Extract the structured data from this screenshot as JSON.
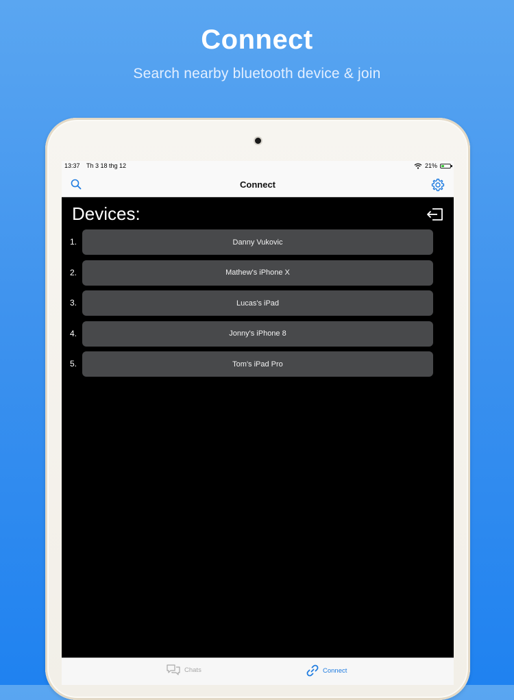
{
  "promo": {
    "title": "Connect",
    "subtitle": "Search nearby bluetooth device & join"
  },
  "status_bar": {
    "time": "13:37",
    "date": "Th 3 18 thg 12",
    "battery": "21%"
  },
  "nav": {
    "title": "Connect",
    "left_icon": "search-icon",
    "right_icon": "gear-icon"
  },
  "devices": {
    "header": "Devices:",
    "exit_icon": "exit-icon",
    "items": [
      {
        "index": "1.",
        "name": "Danny Vukovic"
      },
      {
        "index": "2.",
        "name": "Mathew's iPhone X"
      },
      {
        "index": "3.",
        "name": "Lucas's iPad"
      },
      {
        "index": "4.",
        "name": "Jonny's iPhone 8"
      },
      {
        "index": "5.",
        "name": "Tom's iPad Pro"
      }
    ]
  },
  "tabs": [
    {
      "label": "Chats",
      "icon": "chat-bubbles-icon",
      "active": false
    },
    {
      "label": "Connect",
      "icon": "link-icon",
      "active": true
    }
  ],
  "colors": {
    "accent": "#1e7be0",
    "background_top": "#5aa6f1",
    "background_bottom": "#1f82f0",
    "device_button": "#48494b",
    "screen": "#000000"
  }
}
